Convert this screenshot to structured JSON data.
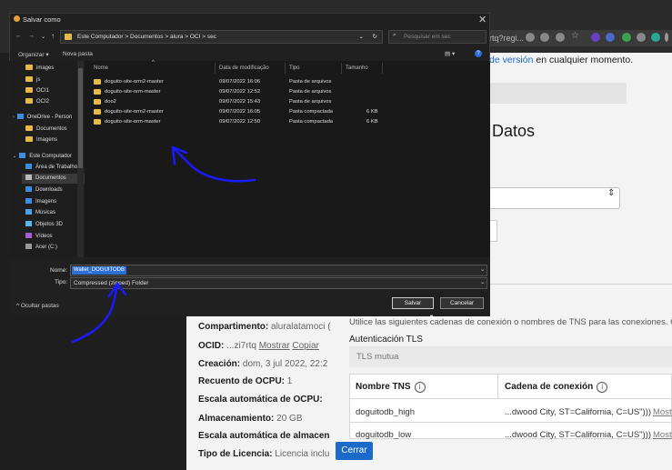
{
  "browser": {
    "address_fragment": "rtq?regi...",
    "toolbar_icons": [
      "zoom-icon",
      "translate-icon",
      "share-icon",
      "star-icon",
      "extension-icon",
      "extension-icon",
      "extension-icon",
      "extension-icon",
      "extension-icon",
      "puzzle-icon",
      "menu-icon"
    ]
  },
  "page": {
    "notice_link": "de versión",
    "notice_text": " en cualquier momento.",
    "section_title": "Datos",
    "connection_description": "Utilice las siguientes cadenas de conexión o nombres de TNS para las conexiones. Co",
    "tls_label": "Autenticación TLS",
    "tls_value": "TLS mutua",
    "table_headers": [
      "Nombre TNS",
      "Cadena de conexión"
    ],
    "table_rows": [
      {
        "tns": "doguitodb_high",
        "conn": "...dwood City, ST=California, C=US\")))",
        "action": "Most"
      },
      {
        "tns": "doguitodb_low",
        "conn": "...dwood City, ST=California, C=US\")))",
        "action": "Most"
      }
    ],
    "close_button": "Cerrar",
    "details": {
      "compartment_label": "Compartimento:",
      "compartment_value": "aluralatamoci (",
      "ocid_label": "OCID:",
      "ocid_value": "...zi7rtq",
      "ocid_show": "Mostrar",
      "ocid_copy": "Copiar",
      "created_label": "Creación:",
      "created_value": "dom, 3 jul 2022, 22:2",
      "ocpu_count_label": "Recuento de OCPU:",
      "ocpu_count_value": "1",
      "ocpu_scale_label": "Escala automática de OCPU:",
      "storage_label": "Almacenamiento:",
      "storage_value": "20 GB",
      "storage_scale_label": "Escala automática de almacen",
      "license_label": "Tipo de Licencia:",
      "license_value": "Licencia inclu"
    }
  },
  "dialog": {
    "title": "Salvar como",
    "path": [
      "Este Computador",
      "Documentos",
      "alura",
      "OCI",
      "sec"
    ],
    "search_placeholder": "Pesquisar em sec",
    "organize": "Organizar ▾",
    "new_folder": "Nova pasta",
    "sidebar_items": [
      {
        "label": "images",
        "icon": "folder-icon"
      },
      {
        "label": "js",
        "icon": "folder-icon"
      },
      {
        "label": "OCI1",
        "icon": "folder-icon"
      },
      {
        "label": "OCI2",
        "icon": "folder-icon"
      },
      {
        "label": "OneDrive - Person",
        "icon": "cloud-icon"
      },
      {
        "label": "Documentos",
        "icon": "folder-icon"
      },
      {
        "label": "Imagens",
        "icon": "folder-icon"
      },
      {
        "label": "Este Computador",
        "icon": "computer-icon"
      },
      {
        "label": "Área de Trabalho",
        "icon": "desktop-icon"
      },
      {
        "label": "Documentos",
        "icon": "documents-icon"
      },
      {
        "label": "Downloads",
        "icon": "download-icon"
      },
      {
        "label": "Imagens",
        "icon": "image-icon"
      },
      {
        "label": "Músicas",
        "icon": "music-icon"
      },
      {
        "label": "Objetos 3D",
        "icon": "cube-icon"
      },
      {
        "label": "Vídeos",
        "icon": "video-icon"
      },
      {
        "label": "Acer (C:)",
        "icon": "drive-icon"
      }
    ],
    "columns": [
      "Nome",
      "Data de modificação",
      "Tipo",
      "Tamanho"
    ],
    "files": [
      {
        "name": "doguito-site-orm2-master",
        "date": "09/07/2022 16:06",
        "type": "Pasta de arquivos",
        "size": ""
      },
      {
        "name": "doguito-site-orm-master",
        "date": "09/07/2022 12:52",
        "type": "Pasta de arquivos",
        "size": ""
      },
      {
        "name": "doo2",
        "date": "09/07/2022 15:43",
        "type": "Pasta de arquivos",
        "size": ""
      },
      {
        "name": "doguito-site-orm2-master",
        "date": "09/07/2022 16:05",
        "type": "Pasta compactada",
        "size": "6 KB"
      },
      {
        "name": "doguito-site-orm-master",
        "date": "09/07/2022 12:50",
        "type": "Pasta compactada",
        "size": "6 KB"
      }
    ],
    "name_label": "Nome:",
    "name_value": "Wallet_DOGUITODB",
    "type_label": "Tipo:",
    "type_value": "Compressed (zipped) Folder",
    "hide_folders": "Ocultar pastas",
    "save_button": "Salvar",
    "cancel_button": "Cancelar"
  },
  "colors": {
    "dialog_bg": "#202020",
    "selection": "#2b6fd6",
    "page_accent": "#1b6ac9",
    "annotation": "#1a1aff"
  }
}
